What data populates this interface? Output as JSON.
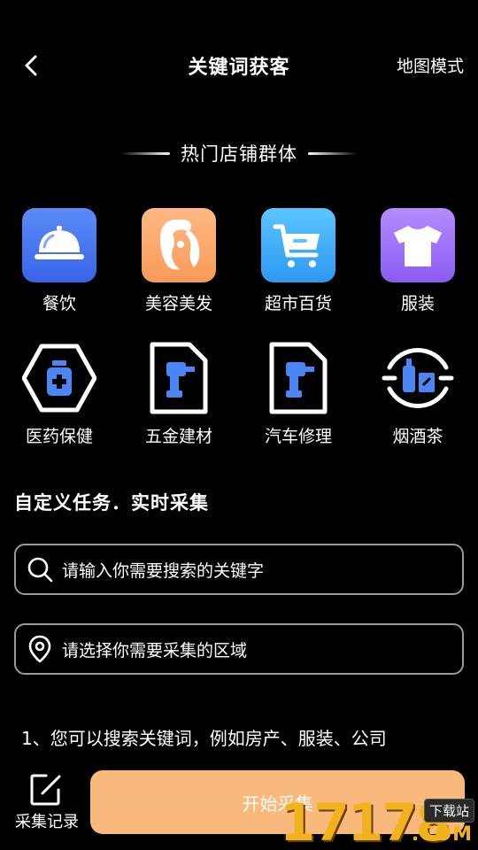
{
  "header": {
    "title": "关键词获客",
    "map_mode": "地图模式"
  },
  "hot_section": {
    "title": "热门店铺群体"
  },
  "categories": [
    {
      "label": "餐饮",
      "icon": "cloche-icon",
      "color_top": "#5b8cf7",
      "color_bottom": "#3a63e8"
    },
    {
      "label": "美容美发",
      "icon": "hair-icon",
      "color_top": "#ffb884",
      "color_bottom": "#f79a59"
    },
    {
      "label": "超市百货",
      "icon": "shopping-cart-icon",
      "color_top": "#5cc5ff",
      "color_bottom": "#2e98f2"
    },
    {
      "label": "服装",
      "icon": "tshirt-icon",
      "color_top": "#b58cff",
      "color_bottom": "#8b5bf2"
    },
    {
      "label": "医药保健",
      "icon": "medicine-bottle-icon"
    },
    {
      "label": "五金建材",
      "icon": "power-drill-icon"
    },
    {
      "label": "汽车修理",
      "icon": "power-drill-icon"
    },
    {
      "label": "烟酒茶",
      "icon": "bottles-icon"
    }
  ],
  "task": {
    "title": "自定义任务．实时采集",
    "keyword_placeholder": "请输入你需要搜索的关键字",
    "region_placeholder": "请选择你需要采集的区域",
    "hint": "1、您可以搜索关键词，例如房产、服装、公司"
  },
  "bottom": {
    "record_label": "采集记录",
    "start_label": "开始采集"
  },
  "watermark": {
    "number": "17178",
    "tag": "下载站",
    "domain": ".COM"
  },
  "colors": {
    "background": "#000000",
    "accent": "#f9b97c",
    "icon_blue": "#4a86f5"
  }
}
